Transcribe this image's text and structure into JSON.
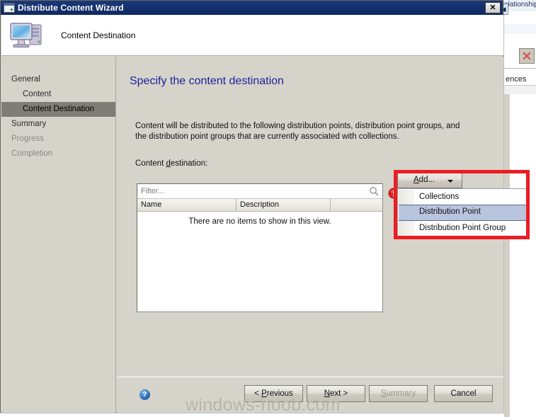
{
  "window": {
    "title": "Distribute Content Wizard",
    "title_icon": "wizard-window-icon",
    "close_label": "✕"
  },
  "wizard_header": {
    "icon": "computer-icon",
    "title": "Content Destination"
  },
  "nav": {
    "items": [
      {
        "label": "General",
        "state": "normal",
        "indent": false
      },
      {
        "label": "Content",
        "state": "normal",
        "indent": true
      },
      {
        "label": "Content Destination",
        "state": "selected",
        "indent": true
      },
      {
        "label": "Summary",
        "state": "normal",
        "indent": false
      },
      {
        "label": "Progress",
        "state": "disabled",
        "indent": false
      },
      {
        "label": "Completion",
        "state": "disabled",
        "indent": false
      }
    ]
  },
  "page": {
    "heading": "Specify the content destination",
    "description": "Content will be distributed to the following distribution points, distribution point groups, and the distribution point groups that are currently associated with collections.",
    "destination_label_pre": "Content ",
    "destination_label_accel": "d",
    "destination_label_post": "estination:"
  },
  "listview": {
    "filter_placeholder": "Filter...",
    "filter_value": "",
    "search_icon": "search-icon",
    "columns": [
      "Name",
      "Description",
      ""
    ],
    "rows": [],
    "empty_message": "There are no items to show in this view.",
    "error_icon": "error-exclamation-icon"
  },
  "add_control": {
    "button_label_pre": "",
    "button_accel": "A",
    "button_label_post": "dd...",
    "caret_icon": "chevron-down-icon",
    "menu_items": [
      {
        "label": "Collections",
        "highlighted": false
      },
      {
        "label": "Distribution Point",
        "highlighted": true
      },
      {
        "label": "Distribution Point Group",
        "highlighted": false
      }
    ]
  },
  "annotation": {
    "highlight_color": "#ee1c23"
  },
  "footer": {
    "help_icon": "help-question-icon",
    "help_label": "?",
    "buttons": [
      {
        "name": "previous",
        "pre": "< ",
        "accel": "P",
        "post": "revious",
        "disabled": false
      },
      {
        "name": "next",
        "pre": "",
        "accel": "N",
        "post": "ext >",
        "disabled": false
      },
      {
        "name": "summary",
        "pre": "",
        "accel": "S",
        "post": "ummary",
        "disabled": true
      },
      {
        "name": "cancel",
        "pre": "",
        "accel": "",
        "post": "Cancel",
        "disabled": false
      }
    ]
  },
  "watermark": {
    "text": "windows-noob.com"
  },
  "background_app": {
    "relationship_text": "elationship",
    "references_text": "ences",
    "delete_icon": "delete-x-icon",
    "collapse_icon": "collapse-left-icon",
    "collapse_label": "◀"
  }
}
